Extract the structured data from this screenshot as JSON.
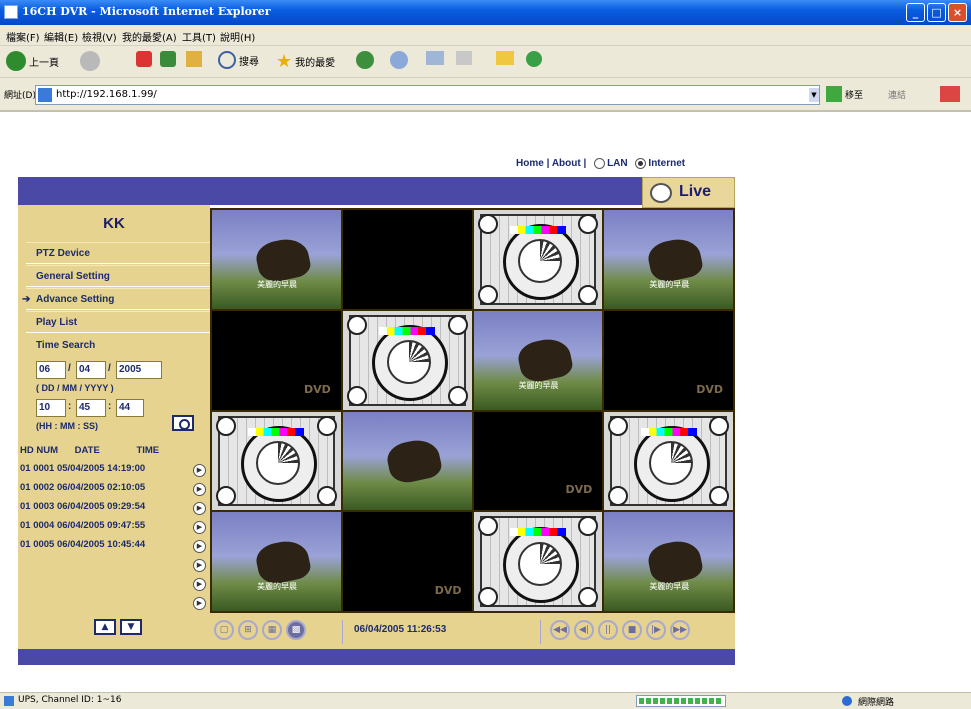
{
  "window": {
    "title": "16CH DVR - Microsoft Internet Explorer"
  },
  "menu": [
    "檔案(F)",
    "編輯(E)",
    "檢視(V)",
    "我的最愛(A)",
    "工具(T)",
    "說明(H)"
  ],
  "toolbar": {
    "back": "上一頁",
    "search": "搜尋",
    "favorites": "我的最愛"
  },
  "address": {
    "label": "網址(D)",
    "url": "http://192.168.1.99/",
    "go": "移至",
    "links": "連結"
  },
  "top_links": {
    "home": "Home",
    "about": "About",
    "sep": "|",
    "lan": "LAN",
    "internet": "Internet",
    "selected": "Internet"
  },
  "tab": {
    "live": "Live"
  },
  "sidebar": {
    "title": "KK",
    "items": [
      {
        "label": "PTZ Device"
      },
      {
        "label": "General Setting"
      },
      {
        "label": "Advance Setting",
        "active": true
      },
      {
        "label": "Play List"
      }
    ],
    "time_search": {
      "label": "Time Search",
      "day": "06",
      "month": "04",
      "year": "2005",
      "date_format": "( DD / MM / YYYY )",
      "hour": "10",
      "minute": "45",
      "second": "44",
      "time_format": "(HH : MM : SS)"
    },
    "records_header": {
      "hd": "HD",
      "num": "NUM",
      "date": "DATE",
      "time": "TIME"
    },
    "records": [
      "01 0001 05/04/2005 14:19:00",
      "01 0002 06/04/2005 02:10:05",
      "01 0003 06/04/2005 09:29:54",
      "01 0004 06/04/2005 09:47:55",
      "01 0005 06/04/2005 10:45:44"
    ]
  },
  "cameras": [
    {
      "type": "photo",
      "caption": "美麗的早晨"
    },
    {
      "type": "black"
    },
    {
      "type": "test"
    },
    {
      "type": "photo",
      "caption": "美麗的早晨"
    },
    {
      "type": "dvd"
    },
    {
      "type": "test"
    },
    {
      "type": "photo",
      "caption": "美麗的早晨"
    },
    {
      "type": "dvd"
    },
    {
      "type": "test"
    },
    {
      "type": "photo",
      "caption": ""
    },
    {
      "type": "dvd"
    },
    {
      "type": "test"
    },
    {
      "type": "photo",
      "caption": "美麗的早晨"
    },
    {
      "type": "dvd"
    },
    {
      "type": "test"
    },
    {
      "type": "photo",
      "caption": "美麗的早晨"
    }
  ],
  "controls": {
    "timestamp": "06/04/2005 11:26:53"
  },
  "status": {
    "text": "UPS, Channel ID: 1~16",
    "zone": "網際網路"
  }
}
